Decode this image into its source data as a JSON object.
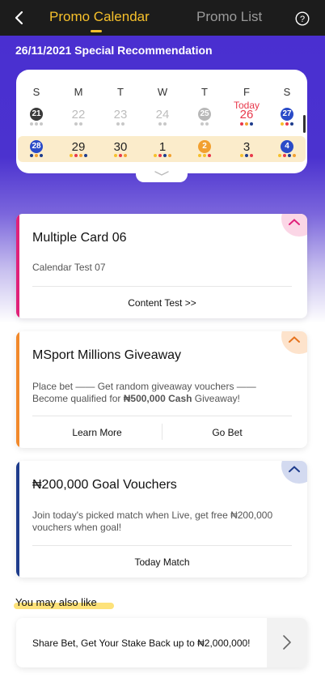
{
  "header": {
    "tabs": [
      {
        "label": "Promo Calendar",
        "active": true
      },
      {
        "label": "Promo List",
        "active": false
      }
    ],
    "icons": {
      "back": "back-arrow-icon",
      "help": "help-circle-icon"
    }
  },
  "recommendation_title": "26/11/2021 Special Recommendation",
  "calendar": {
    "weekdays": [
      "S",
      "M",
      "T",
      "W",
      "T",
      "F",
      "S"
    ],
    "today_label": "Today",
    "week1": [
      {
        "day": "21",
        "style": "ball",
        "color": "#3a3a3a",
        "dots": [
          "#c8c8c8",
          "#c8c8c8",
          "#c8c8c8"
        ]
      },
      {
        "day": "22",
        "style": "past",
        "dots": [
          "#c8c8c8",
          "#c8c8c8"
        ]
      },
      {
        "day": "23",
        "style": "past",
        "dots": [
          "#c8c8c8",
          "#c8c8c8"
        ]
      },
      {
        "day": "24",
        "style": "past",
        "dots": [
          "#c8c8c8",
          "#c8c8c8"
        ]
      },
      {
        "day": "25",
        "style": "ball",
        "color": "#b8b8b8",
        "dots": [
          "#c8c8c8",
          "#c8c8c8"
        ]
      },
      {
        "day": "26",
        "style": "today",
        "dots": [
          "#e8384b",
          "#f2a030",
          "#1e3c8c"
        ]
      },
      {
        "day": "27",
        "style": "ball",
        "color": "#2a4bc8",
        "dots": [
          "#f6c02b",
          "#e8384b",
          "#1e3c8c"
        ]
      }
    ],
    "week2": [
      {
        "day": "28",
        "style": "ball",
        "color": "#2a4bc8",
        "dots": [
          "#1e3c8c",
          "#f2a030",
          "#1e3c8c"
        ]
      },
      {
        "day": "29",
        "style": "plain",
        "dots": [
          "#f6c02b",
          "#e8384b",
          "#f2a030",
          "#1e3c8c"
        ]
      },
      {
        "day": "30",
        "style": "plain",
        "dots": [
          "#f6c02b",
          "#e8384b",
          "#f2a030"
        ]
      },
      {
        "day": "1",
        "style": "plain",
        "dots": [
          "#f6c02b",
          "#e8384b",
          "#1e3c8c",
          "#f2a030"
        ]
      },
      {
        "day": "2",
        "style": "ball",
        "color": "#f2a030",
        "dots": [
          "#f6c02b",
          "#f6c02b",
          "#e8384b"
        ]
      },
      {
        "day": "3",
        "style": "plain",
        "dots": [
          "#f6c02b",
          "#1e3c8c",
          "#e8384b"
        ]
      },
      {
        "day": "4",
        "style": "ball",
        "color": "#2a4bc8",
        "dots": [
          "#f6c02b",
          "#e8384b",
          "#1e3c8c",
          "#f2a030"
        ]
      }
    ]
  },
  "cards": [
    {
      "title": "Multiple Card 06",
      "description": "Calendar Test 07",
      "stripe_color": "#e0217a",
      "corner_bg": "#fbd6e6",
      "corner_arrow": "#e0217a",
      "actions": [
        "Content Test >>"
      ]
    },
    {
      "title": "MSport Millions Giveaway",
      "description_plain": "Place bet —— Get random giveaway vouchers —— Become qualified for ",
      "description_bold": "₦500,000 Cash",
      "description_end": " Giveaway!",
      "stripe_color": "#f2892b",
      "corner_bg": "#fde3cc",
      "corner_arrow": "#e6731f",
      "actions": [
        "Learn More",
        "Go Bet"
      ]
    },
    {
      "title": "₦200,000 Goal Vouchers",
      "description": "Join today's picked match when Live, get free ₦200,000 vouchers when goal!",
      "stripe_color": "#1e3c8c",
      "corner_bg": "#d3daf0",
      "corner_arrow": "#1e3c8c",
      "actions": [
        "Today Match"
      ]
    }
  ],
  "also_like": {
    "title": "You may also like",
    "items": [
      {
        "text": "Share Bet, Get Your Stake Back up to ₦2,000,000!"
      }
    ]
  }
}
